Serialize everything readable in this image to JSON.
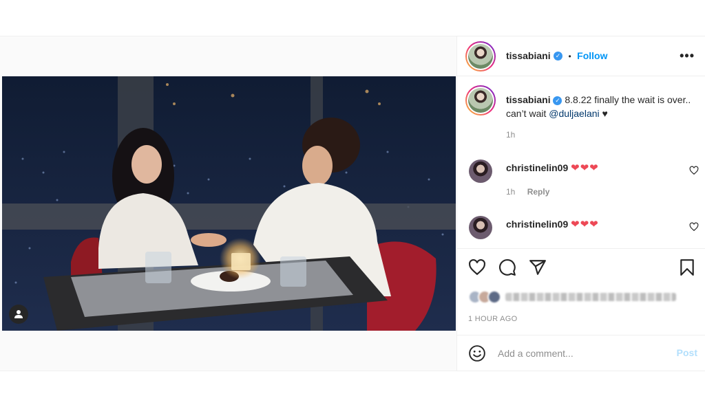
{
  "post": {
    "username": "tissabiani",
    "follow_label": "Follow",
    "separator": "•",
    "caption_prefix": "8.8.22 finally the wait is over.. can’t wait ",
    "caption_mention": "@duljaelani",
    "caption_suffix": " ♥",
    "caption_time": "1h",
    "likes_ago": "1 HOUR AGO"
  },
  "comments": [
    {
      "username": "christinelin09",
      "text": "❤❤❤",
      "time": "1h",
      "reply_label": "Reply"
    },
    {
      "username": "christinelin09",
      "text": "❤❤❤"
    }
  ],
  "add_comment": {
    "placeholder": "Add a comment...",
    "post_label": "Post"
  },
  "icons": [
    "more-options-icon",
    "verified-badge-icon",
    "heart-icon",
    "comment-icon",
    "share-icon",
    "bookmark-icon",
    "emoji-icon",
    "user-tag-icon"
  ],
  "colors": {
    "link_blue": "#0095f6",
    "heart_red": "#ed4956",
    "verified": "#3897f0",
    "muted": "#8e8e8e",
    "post_disabled": "#b2dffc"
  }
}
